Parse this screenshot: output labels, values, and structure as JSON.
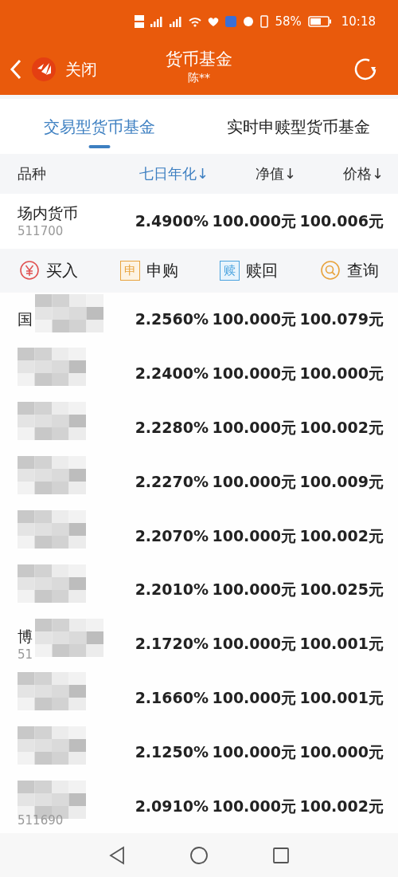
{
  "status_bar": {
    "battery": "58%",
    "time": "10:18"
  },
  "header": {
    "back_label": "关闭",
    "title": "货币基金",
    "subtitle": "陈**"
  },
  "tabs": [
    {
      "label": "交易型货币基金",
      "selected": true
    },
    {
      "label": "实时申赎型货币基金",
      "selected": false
    }
  ],
  "table": {
    "columns": [
      {
        "label": "品种",
        "selected": false
      },
      {
        "label": "七日年化↓",
        "selected": true
      },
      {
        "label": "净值↓",
        "selected": false
      },
      {
        "label": "价格↓",
        "selected": false
      }
    ],
    "rows": [
      {
        "name": "场内货币",
        "code": "511700",
        "rate": "2.4900%",
        "nav": "100.000元",
        "price": "100.006元",
        "blurred": false
      },
      {
        "kind": "actions",
        "actions": [
          {
            "kind": "buy",
            "label": "买入"
          },
          {
            "kind": "subscribe",
            "label": "申购",
            "icon": "申"
          },
          {
            "kind": "redeem",
            "label": "赎回",
            "icon": "赎"
          },
          {
            "kind": "query",
            "label": "查询"
          }
        ]
      },
      {
        "name": "国",
        "rate": "2.2560%",
        "nav": "100.000元",
        "price": "100.079元",
        "blurred": true
      },
      {
        "rate": "2.2400%",
        "nav": "100.000元",
        "price": "100.000元",
        "blurred": true
      },
      {
        "rate": "2.2280%",
        "nav": "100.000元",
        "price": "100.002元",
        "blurred": true
      },
      {
        "rate": "2.2270%",
        "nav": "100.000元",
        "price": "100.009元",
        "blurred": true
      },
      {
        "rate": "2.2070%",
        "nav": "100.000元",
        "price": "100.002元",
        "blurred": true
      },
      {
        "rate": "2.2010%",
        "nav": "100.000元",
        "price": "100.025元",
        "blurred": true
      },
      {
        "name": "博",
        "code": "51",
        "rate": "2.1720%",
        "nav": "100.000元",
        "price": "100.001元",
        "blurred": true
      },
      {
        "rate": "2.1660%",
        "nav": "100.000元",
        "price": "100.001元",
        "blurred": true
      },
      {
        "rate": "2.1250%",
        "nav": "100.000元",
        "price": "100.000元",
        "blurred": true
      },
      {
        "code": "511690",
        "rate": "2.0910%",
        "nav": "100.000元",
        "price": "100.002元",
        "blurred": true
      }
    ]
  }
}
